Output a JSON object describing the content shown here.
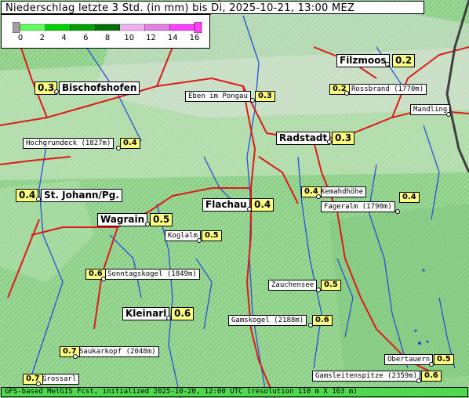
{
  "title": "Niederschlag letzte 3 Std. (in mm) bis Di, 2025-10-21, 13:00 MEZ",
  "legend": {
    "ticks": [
      "0",
      "2",
      "4",
      "6",
      "8",
      "10",
      "12",
      "14",
      "16"
    ],
    "colors": [
      "#a0a0a0",
      "#60ff60",
      "#00d000",
      "#00a000",
      "#007000",
      "#f0b0f0",
      "#e080e0",
      "#ff40ff"
    ]
  },
  "places": [
    {
      "name": "Filzmoos",
      "value": "0.2",
      "big": true
    },
    {
      "name": "Bischofshofen",
      "value": "0.3",
      "big": true
    },
    {
      "name": "Rossbrand (1770m)",
      "value": "0.2",
      "big": false
    },
    {
      "name": "Eben im Pongau",
      "value": "0.3",
      "big": false
    },
    {
      "name": "Mandling",
      "value": "",
      "big": false
    },
    {
      "name": "Hochgrundeck (1827m)",
      "value": "0.4",
      "big": false
    },
    {
      "name": "Radstadt",
      "value": "0.3",
      "big": true
    },
    {
      "name": "St. Johann/Pg.",
      "value": "0.4",
      "big": true
    },
    {
      "name": "Kemahdhöhe",
      "value": "0.4",
      "big": false
    },
    {
      "name": "Fageralm (1790m)",
      "value": "0.4",
      "big": false
    },
    {
      "name": "Flachau",
      "value": "0.4",
      "big": true
    },
    {
      "name": "Wagrain",
      "value": "0.5",
      "big": true
    },
    {
      "name": "Koglalm",
      "value": "0.5",
      "big": false
    },
    {
      "name": "Sonntagskogel (1849m)",
      "value": "0.6",
      "big": false
    },
    {
      "name": "Zauchensee",
      "value": "0.5",
      "big": false
    },
    {
      "name": "Kleinarl",
      "value": "0.6",
      "big": true
    },
    {
      "name": "Gamskogel (2188m)",
      "value": "0.6",
      "big": false
    },
    {
      "name": "Saukarkopf (2048m)",
      "value": "0.7",
      "big": false
    },
    {
      "name": "Obertauern",
      "value": "0.5",
      "big": false
    },
    {
      "name": "Grossarl",
      "value": "0.7",
      "big": false
    },
    {
      "name": "Gamsleitenspitze (2359m)",
      "value": "0.6",
      "big": false
    }
  ],
  "footer": "GFS-based MetGIS Fcst, initialized 2025-10-20, 12:00 UTC  (resolution 110 m X 163 m)"
}
